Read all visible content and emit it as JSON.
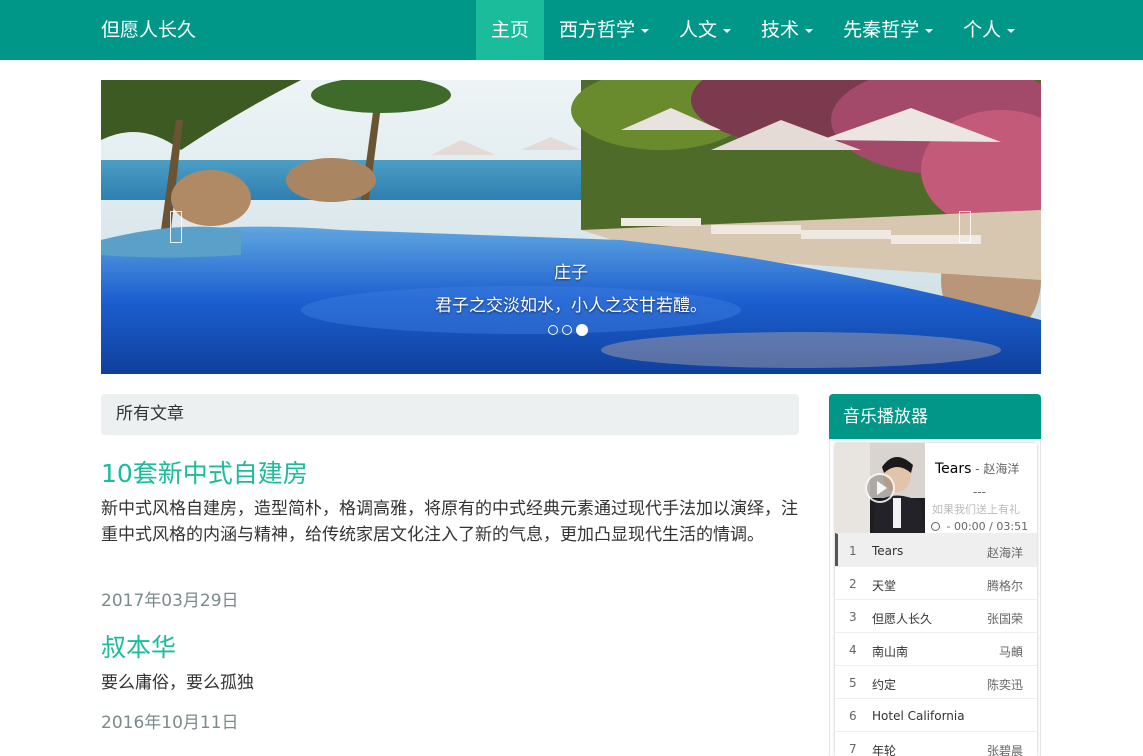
{
  "navbar": {
    "brand": "但愿人长久",
    "items": [
      {
        "label": "主页",
        "active": true,
        "dropdown": false
      },
      {
        "label": "西方哲学",
        "active": false,
        "dropdown": true
      },
      {
        "label": "人文",
        "active": false,
        "dropdown": true
      },
      {
        "label": "技术",
        "active": false,
        "dropdown": true
      },
      {
        "label": "先秦哲学",
        "active": false,
        "dropdown": true
      },
      {
        "label": "个人",
        "active": false,
        "dropdown": true
      }
    ],
    "color": "#009688",
    "active_color": "#1abc9c"
  },
  "carousel": {
    "caption_title": "庄子",
    "caption_text": "君子之交淡如水，小人之交甘若醴。",
    "slide_count": 3,
    "active_index": 2
  },
  "articles_section": {
    "heading": "所有文章",
    "articles": [
      {
        "title": "10套新中式自建房",
        "summary": "新中式风格自建房，造型简朴，格调高雅，将原有的中式经典元素通过现代手法加以演绎，注重中式风格的内涵与精神，给传统家居文化注入了新的气息，更加凸显现代生活的情调。",
        "date": "2017年03月29日"
      },
      {
        "title": "叔本华",
        "summary": "要么庸俗，要么孤独",
        "date": "2016年10月11日"
      }
    ],
    "title_color": "#1abc9c"
  },
  "music_player": {
    "heading": "音乐播放器",
    "now_playing": {
      "title": "Tears",
      "artist": " - 赵海洋",
      "dashes": "---",
      "lyric": "如果我们送上有礼",
      "time": "00:00 / 03:51"
    },
    "playlist": [
      {
        "index": "1",
        "title": "Tears",
        "artist": "赵海洋",
        "playing": true
      },
      {
        "index": "2",
        "title": "天堂",
        "artist": "腾格尔",
        "playing": false
      },
      {
        "index": "3",
        "title": "但愿人长久",
        "artist": "张国荣",
        "playing": false
      },
      {
        "index": "4",
        "title": "南山南",
        "artist": "马頔",
        "playing": false
      },
      {
        "index": "5",
        "title": "约定",
        "artist": "陈奕迅",
        "playing": false
      },
      {
        "index": "6",
        "title": "Hotel California",
        "artist": "",
        "playing": false
      },
      {
        "index": "7",
        "title": "年轮",
        "artist": "张碧晨",
        "playing": false
      }
    ]
  }
}
